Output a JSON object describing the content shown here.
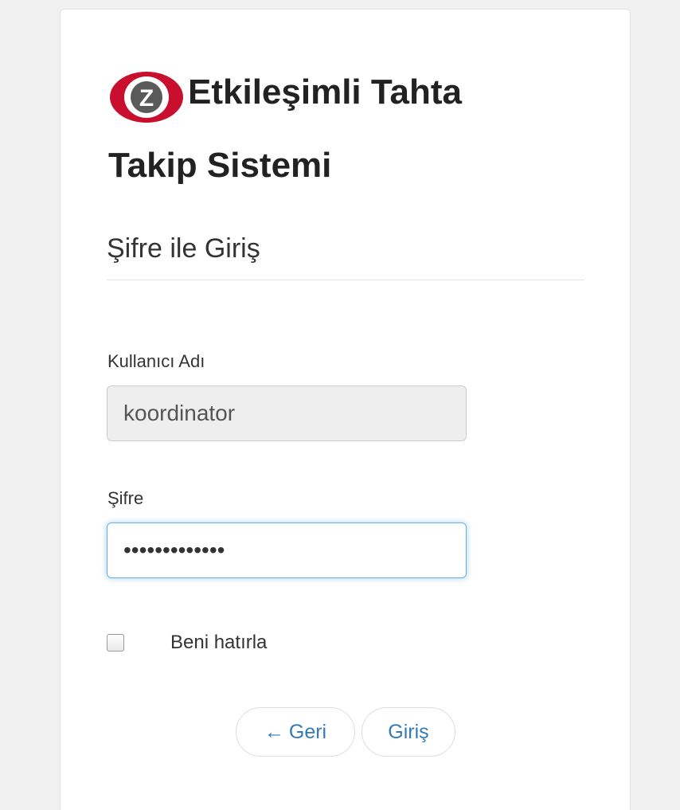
{
  "header": {
    "title_line1": "Etkileşimli Tahta",
    "title_line2": "Takip Sistemi",
    "logo_icon": "z-logo-icon",
    "logo_letter": "Z"
  },
  "form": {
    "heading": "Şifre ile Giriş",
    "username_label": "Kullanıcı Adı",
    "username_value": "koordinator",
    "password_label": "Şifre",
    "password_masked": "•••••••••••••",
    "remember_label": "Beni hatırla",
    "remember_checked": false
  },
  "buttons": {
    "back_arrow": "←",
    "back_label": "Geri",
    "login_label": "Giriş"
  },
  "colors": {
    "accent": "#337ab7",
    "focus_border": "#66afe9",
    "logo_red": "#c8102e",
    "logo_gray": "#5a5a5a"
  }
}
